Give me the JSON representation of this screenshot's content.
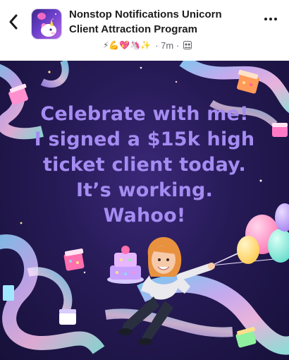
{
  "header": {
    "title_line1": "Nonstop Notifications Unicorn",
    "title_line2": "Client Attraction Program",
    "emojis": "⚡💪💖🦄✨",
    "time": "· 7m ·",
    "back_icon": "chevron-left-icon",
    "more_icon": "ellipsis-icon",
    "privacy_icon": "group-icon"
  },
  "post": {
    "lines": [
      "Celebrate with me!",
      "I signed a $15k high",
      "ticket client today.",
      "It’s working.",
      "Wahoo!"
    ],
    "text_color": "#a58cf2",
    "background_color": "#1f1648"
  }
}
